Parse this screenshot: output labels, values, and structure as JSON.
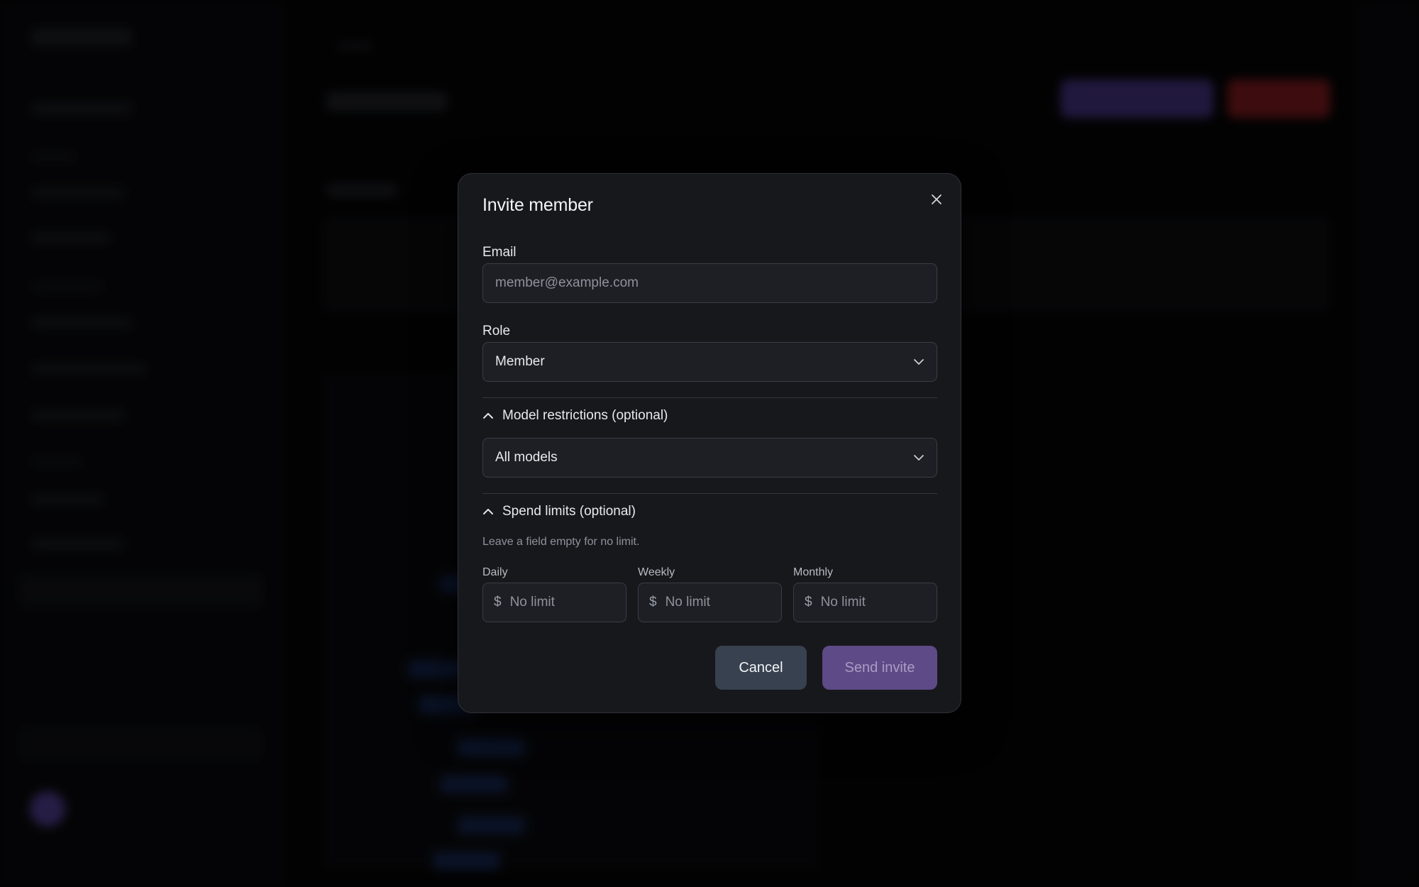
{
  "modal": {
    "title": "Invite member",
    "close_icon": "close-icon",
    "email": {
      "label": "Email",
      "placeholder": "member@example.com",
      "value": ""
    },
    "role": {
      "label": "Role",
      "selected": "Member",
      "icon": "chevron-down-icon"
    },
    "model_restrictions": {
      "label": "Model restrictions (optional)",
      "expanded": true,
      "icon": "chevron-up-icon",
      "selected": "All models"
    },
    "spend_limits": {
      "label": "Spend limits (optional)",
      "expanded": true,
      "icon": "chevron-up-icon",
      "hint": "Leave a field empty for no limit.",
      "currency_symbol": "$",
      "fields": [
        {
          "label": "Daily",
          "placeholder": "No limit"
        },
        {
          "label": "Weekly",
          "placeholder": "No limit"
        },
        {
          "label": "Monthly",
          "placeholder": "No limit"
        }
      ]
    },
    "actions": {
      "cancel_label": "Cancel",
      "send_label": "Send invite"
    }
  },
  "colors": {
    "modal_bg": "#17181c",
    "input_bg": "#1d1f24",
    "cancel_button": "#38414f",
    "send_button_disabled": "#5e4a86",
    "backdrop_accent_purple": "#6c4fc9",
    "backdrop_accent_red": "#c7272d"
  }
}
